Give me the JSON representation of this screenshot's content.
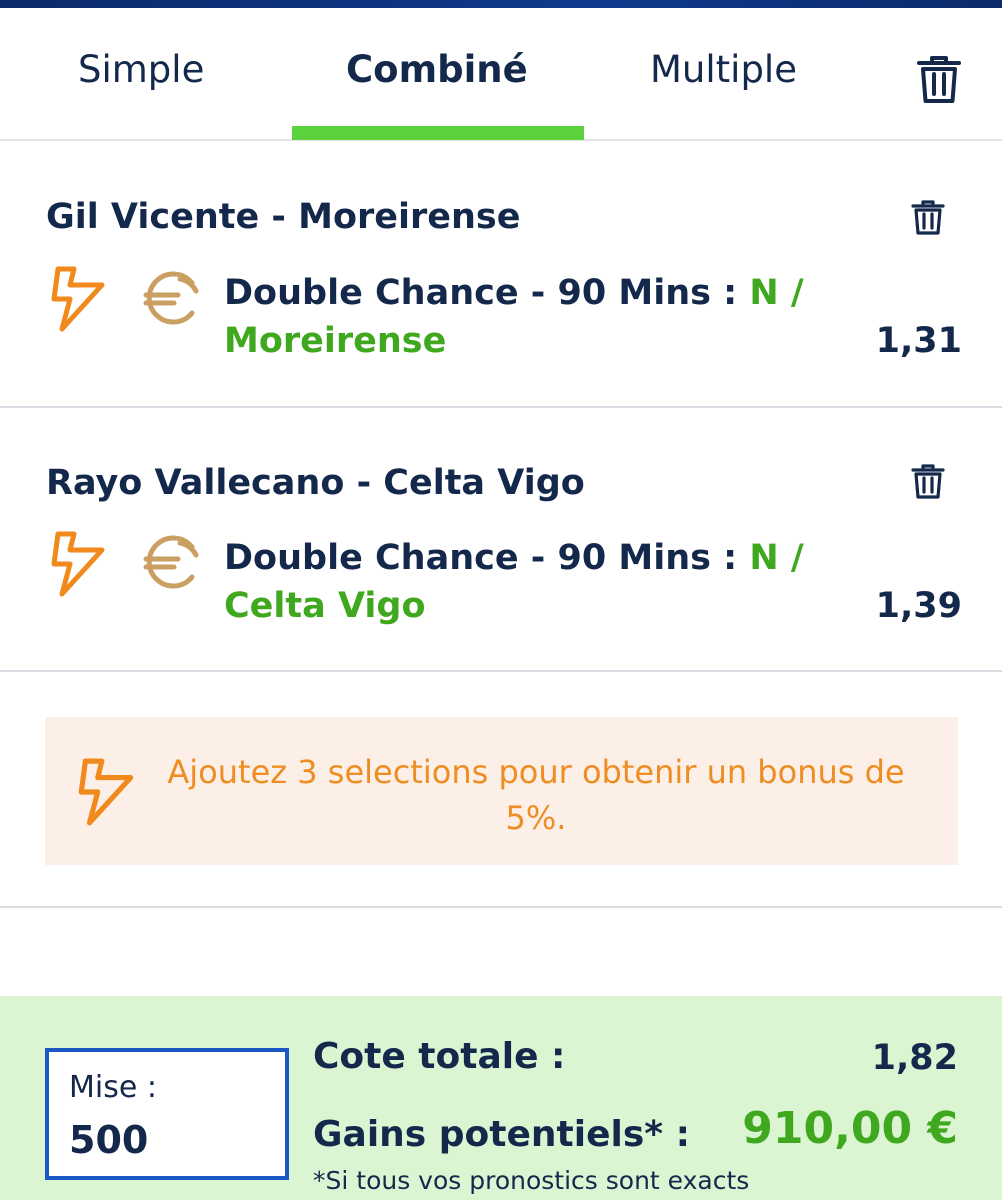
{
  "tabs": {
    "simple": "Simple",
    "combine": "Combiné",
    "multiple": "Multiple"
  },
  "bets": [
    {
      "match": "Gil Vicente - Moreirense",
      "market": "Double Chance - 90 Mins :",
      "selection_part1": "N /",
      "selection_part2": "Moreirense",
      "odd": "1,31"
    },
    {
      "match": "Rayo Vallecano - Celta Vigo",
      "market": "Double Chance - 90 Mins :",
      "selection_part1": "N /",
      "selection_part2": "Celta Vigo",
      "odd": "1,39"
    }
  ],
  "promo": {
    "text": "Ajoutez 3 selections pour obtenir un bonus de 5%."
  },
  "footer": {
    "stake_label": "Mise :",
    "stake_value": "500",
    "total_label": "Cote totale :",
    "total_value": "1,82",
    "gains_label": "Gains potentiels* :",
    "gains_value": "910,00 €",
    "disclaimer": "*Si tous vos pronostics sont exacts"
  },
  "colors": {
    "navy": "#14284b",
    "green": "#3fa81f",
    "tab_underline": "#5bd23c",
    "orange": "#ee8e22",
    "euro_gold": "#c9a062",
    "promo_bg": "#fcefe8",
    "footer_bg": "#dbf5d2",
    "stake_border": "#1a56c4"
  },
  "icons": {
    "trash": "trash-icon",
    "bolt": "lightning-bolt-icon",
    "euro": "euro-coin-icon"
  }
}
